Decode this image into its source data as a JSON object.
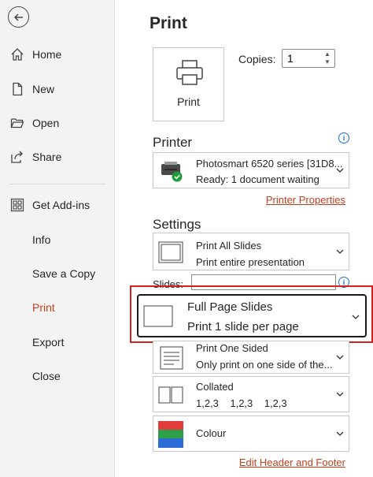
{
  "sidebar": {
    "items": [
      {
        "label": "Home",
        "icon": "home-icon"
      },
      {
        "label": "New",
        "icon": "new-document-icon"
      },
      {
        "label": "Open",
        "icon": "folder-icon"
      },
      {
        "label": "Share",
        "icon": "share-icon"
      },
      {
        "label": "Get Add-ins",
        "icon": "grid-icon"
      },
      {
        "label": "Info"
      },
      {
        "label": "Save a Copy"
      },
      {
        "label": "Print",
        "active": true
      },
      {
        "label": "Export"
      },
      {
        "label": "Close"
      }
    ]
  },
  "main": {
    "title": "Print",
    "print_button_label": "Print",
    "copies_label": "Copies:",
    "copies_value": "1",
    "printer": {
      "heading": "Printer",
      "name": "Photosmart 6520 series [31D8...",
      "status": "Ready: 1 document waiting",
      "properties_link": "Printer Properties"
    },
    "settings": {
      "heading": "Settings",
      "range": {
        "line1": "Print All Slides",
        "line2": "Print entire presentation"
      },
      "slides_label": "Slides:",
      "slides_value": "",
      "layout": {
        "line1": "Full Page Slides",
        "line2": "Print 1 slide per page"
      },
      "sides": {
        "line1": "Print One Sided",
        "line2": "Only print on one side of the..."
      },
      "collation": {
        "line1": "Collated",
        "line2": "1,2,3    1,2,3    1,2,3"
      },
      "color": {
        "line1": "Colour"
      },
      "header_footer_link": "Edit Header and Footer"
    }
  },
  "colors": {
    "accent": "#c43e1c",
    "highlight": "#d21f1f",
    "info": "#1e6fcf"
  }
}
